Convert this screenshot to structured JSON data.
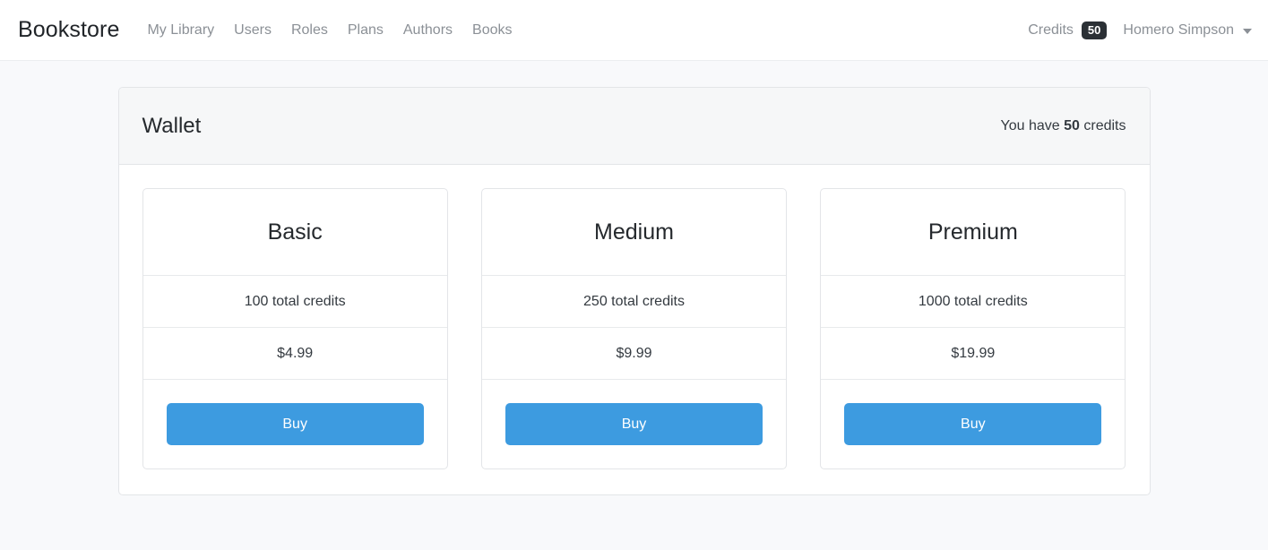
{
  "navbar": {
    "brand": "Bookstore",
    "links": [
      {
        "label": "My Library"
      },
      {
        "label": "Users"
      },
      {
        "label": "Roles"
      },
      {
        "label": "Plans"
      },
      {
        "label": "Authors"
      },
      {
        "label": "Books"
      }
    ],
    "credits_label": "Credits",
    "credits_badge": "50",
    "user_name": "Homero Simpson",
    "caret_icon": "chevron-down-icon"
  },
  "wallet": {
    "title": "Wallet",
    "credits_prefix": "You have ",
    "credits_value": "50",
    "credits_suffix": " credits",
    "plans": [
      {
        "name": "Basic",
        "credits": "100 total credits",
        "price": "$4.99",
        "buy_label": "Buy"
      },
      {
        "name": "Medium",
        "credits": "250 total credits",
        "price": "$9.99",
        "buy_label": "Buy"
      },
      {
        "name": "Premium",
        "credits": "1000 total credits",
        "price": "$19.99",
        "buy_label": "Buy"
      }
    ]
  },
  "colors": {
    "primary": "#3d9be0",
    "badge_bg": "#2b3035",
    "page_bg": "#f8f9fb",
    "card_header_bg": "#f6f7f8",
    "border": "#e3e5e8",
    "muted_text": "#8b9096"
  }
}
